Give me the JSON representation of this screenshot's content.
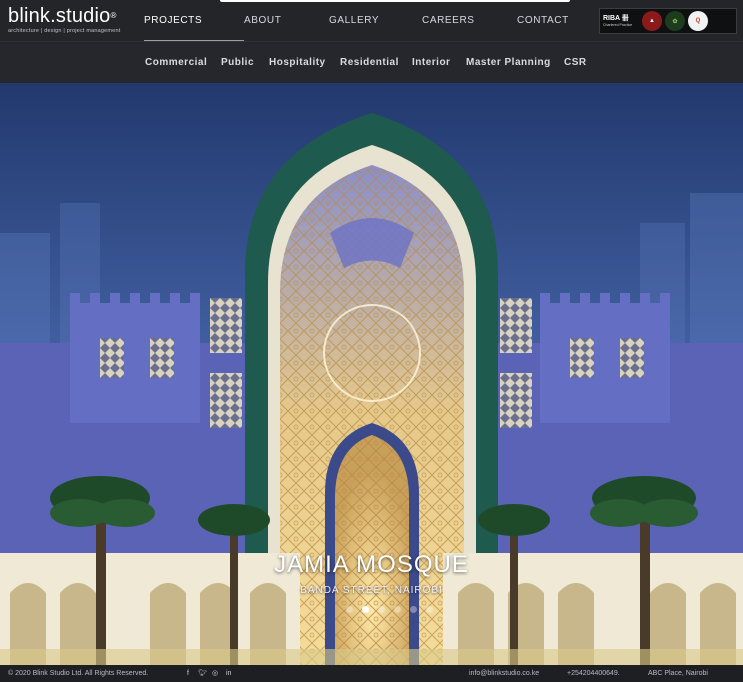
{
  "logo": {
    "brand": "blink.studio",
    "registered": "®",
    "tagline": "architecture | design | project management"
  },
  "main_nav": {
    "items": [
      {
        "label": "PROJECTS",
        "active": true
      },
      {
        "label": "ABOUT",
        "active": false
      },
      {
        "label": "GALLERY",
        "active": false
      },
      {
        "label": "CAREERS",
        "active": false
      },
      {
        "label": "CONTACT",
        "active": false
      }
    ]
  },
  "accreditation": {
    "riba": "RIBA",
    "riba_sub": "Chartered Practice"
  },
  "sub_nav": {
    "items": [
      {
        "label": "Commercial"
      },
      {
        "label": "Public"
      },
      {
        "label": "Hospitality"
      },
      {
        "label": "Residential"
      },
      {
        "label": "Interior"
      },
      {
        "label": "Master Planning"
      },
      {
        "label": "CSR"
      }
    ]
  },
  "hero": {
    "title": "JAMIA MOSQUE",
    "subtitle": "BANDA STREET, NAIROBI",
    "slide_count": 6,
    "active_slide": 1
  },
  "footer": {
    "copyright": "© 2020 Blink Studio Ltd. All Rights Reserved.",
    "social": [
      "facebook-icon",
      "twitter-icon",
      "instagram-icon",
      "linkedin-icon"
    ],
    "email": "info@blinkstudio.co.ke",
    "phone": "+254204400649.",
    "address": "ABC Place, Nairobi"
  },
  "colors": {
    "header_bg": "#232529",
    "subnav_bg": "#25272c",
    "dome_green": "#1f5a4f",
    "facade_blue": "#5a63b5",
    "sky": "#2d4a86"
  }
}
